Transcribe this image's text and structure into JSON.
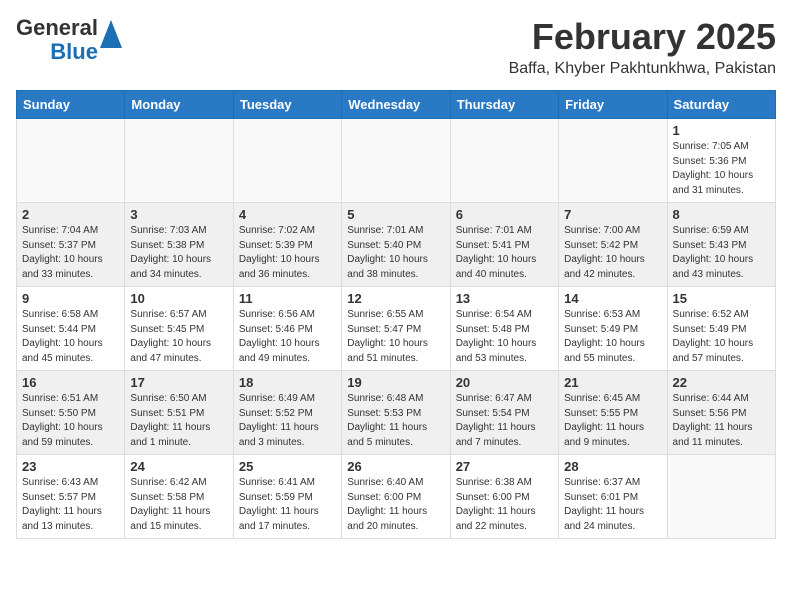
{
  "header": {
    "logo_line1": "General",
    "logo_line2": "Blue",
    "month": "February 2025",
    "location": "Baffa, Khyber Pakhtunkhwa, Pakistan"
  },
  "weekdays": [
    "Sunday",
    "Monday",
    "Tuesday",
    "Wednesday",
    "Thursday",
    "Friday",
    "Saturday"
  ],
  "weeks": [
    [
      {
        "day": "",
        "info": ""
      },
      {
        "day": "",
        "info": ""
      },
      {
        "day": "",
        "info": ""
      },
      {
        "day": "",
        "info": ""
      },
      {
        "day": "",
        "info": ""
      },
      {
        "day": "",
        "info": ""
      },
      {
        "day": "1",
        "info": "Sunrise: 7:05 AM\nSunset: 5:36 PM\nDaylight: 10 hours and 31 minutes."
      }
    ],
    [
      {
        "day": "2",
        "info": "Sunrise: 7:04 AM\nSunset: 5:37 PM\nDaylight: 10 hours and 33 minutes."
      },
      {
        "day": "3",
        "info": "Sunrise: 7:03 AM\nSunset: 5:38 PM\nDaylight: 10 hours and 34 minutes."
      },
      {
        "day": "4",
        "info": "Sunrise: 7:02 AM\nSunset: 5:39 PM\nDaylight: 10 hours and 36 minutes."
      },
      {
        "day": "5",
        "info": "Sunrise: 7:01 AM\nSunset: 5:40 PM\nDaylight: 10 hours and 38 minutes."
      },
      {
        "day": "6",
        "info": "Sunrise: 7:01 AM\nSunset: 5:41 PM\nDaylight: 10 hours and 40 minutes."
      },
      {
        "day": "7",
        "info": "Sunrise: 7:00 AM\nSunset: 5:42 PM\nDaylight: 10 hours and 42 minutes."
      },
      {
        "day": "8",
        "info": "Sunrise: 6:59 AM\nSunset: 5:43 PM\nDaylight: 10 hours and 43 minutes."
      }
    ],
    [
      {
        "day": "9",
        "info": "Sunrise: 6:58 AM\nSunset: 5:44 PM\nDaylight: 10 hours and 45 minutes."
      },
      {
        "day": "10",
        "info": "Sunrise: 6:57 AM\nSunset: 5:45 PM\nDaylight: 10 hours and 47 minutes."
      },
      {
        "day": "11",
        "info": "Sunrise: 6:56 AM\nSunset: 5:46 PM\nDaylight: 10 hours and 49 minutes."
      },
      {
        "day": "12",
        "info": "Sunrise: 6:55 AM\nSunset: 5:47 PM\nDaylight: 10 hours and 51 minutes."
      },
      {
        "day": "13",
        "info": "Sunrise: 6:54 AM\nSunset: 5:48 PM\nDaylight: 10 hours and 53 minutes."
      },
      {
        "day": "14",
        "info": "Sunrise: 6:53 AM\nSunset: 5:49 PM\nDaylight: 10 hours and 55 minutes."
      },
      {
        "day": "15",
        "info": "Sunrise: 6:52 AM\nSunset: 5:49 PM\nDaylight: 10 hours and 57 minutes."
      }
    ],
    [
      {
        "day": "16",
        "info": "Sunrise: 6:51 AM\nSunset: 5:50 PM\nDaylight: 10 hours and 59 minutes."
      },
      {
        "day": "17",
        "info": "Sunrise: 6:50 AM\nSunset: 5:51 PM\nDaylight: 11 hours and 1 minute."
      },
      {
        "day": "18",
        "info": "Sunrise: 6:49 AM\nSunset: 5:52 PM\nDaylight: 11 hours and 3 minutes."
      },
      {
        "day": "19",
        "info": "Sunrise: 6:48 AM\nSunset: 5:53 PM\nDaylight: 11 hours and 5 minutes."
      },
      {
        "day": "20",
        "info": "Sunrise: 6:47 AM\nSunset: 5:54 PM\nDaylight: 11 hours and 7 minutes."
      },
      {
        "day": "21",
        "info": "Sunrise: 6:45 AM\nSunset: 5:55 PM\nDaylight: 11 hours and 9 minutes."
      },
      {
        "day": "22",
        "info": "Sunrise: 6:44 AM\nSunset: 5:56 PM\nDaylight: 11 hours and 11 minutes."
      }
    ],
    [
      {
        "day": "23",
        "info": "Sunrise: 6:43 AM\nSunset: 5:57 PM\nDaylight: 11 hours and 13 minutes."
      },
      {
        "day": "24",
        "info": "Sunrise: 6:42 AM\nSunset: 5:58 PM\nDaylight: 11 hours and 15 minutes."
      },
      {
        "day": "25",
        "info": "Sunrise: 6:41 AM\nSunset: 5:59 PM\nDaylight: 11 hours and 17 minutes."
      },
      {
        "day": "26",
        "info": "Sunrise: 6:40 AM\nSunset: 6:00 PM\nDaylight: 11 hours and 20 minutes."
      },
      {
        "day": "27",
        "info": "Sunrise: 6:38 AM\nSunset: 6:00 PM\nDaylight: 11 hours and 22 minutes."
      },
      {
        "day": "28",
        "info": "Sunrise: 6:37 AM\nSunset: 6:01 PM\nDaylight: 11 hours and 24 minutes."
      },
      {
        "day": "",
        "info": ""
      }
    ]
  ]
}
